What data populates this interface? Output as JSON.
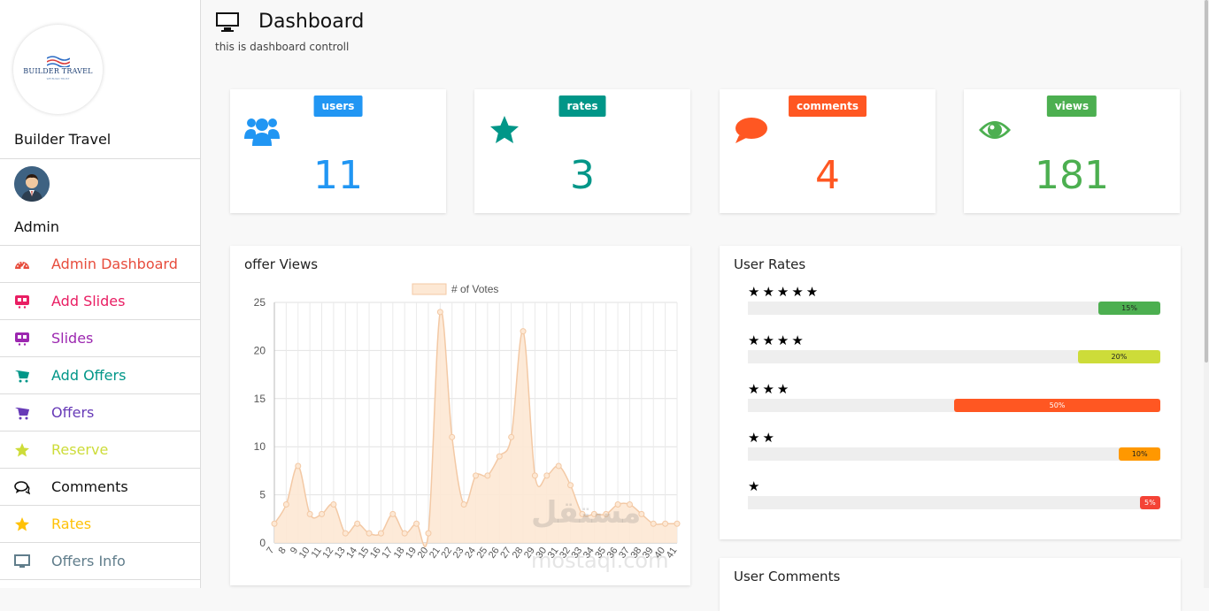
{
  "brand": {
    "logo_text": "BUILDER TRAVEL",
    "logo_sub": "WE BUILD TRUST",
    "name": "Builder Travel"
  },
  "user": {
    "role": "Admin"
  },
  "menu": [
    {
      "label": "Admin Dashboard",
      "icon": "dashboard-gauge-icon",
      "color": "#e74c3c"
    },
    {
      "label": "Add Slides",
      "icon": "slides-icon",
      "color": "#e91e63"
    },
    {
      "label": "Slides",
      "icon": "slides-icon",
      "color": "#9c27b0"
    },
    {
      "label": "Add Offers",
      "icon": "cart-icon",
      "color": "#009688"
    },
    {
      "label": "Offers",
      "icon": "cart-icon",
      "color": "#673ab7"
    },
    {
      "label": "Reserve",
      "icon": "star-icon",
      "color": "#cddc39"
    },
    {
      "label": "Comments",
      "icon": "comments-icon",
      "color": "#111111"
    },
    {
      "label": "Rates",
      "icon": "star-icon",
      "color": "#ffc107"
    },
    {
      "label": "Offers Info",
      "icon": "monitor-icon",
      "color": "#607d8b"
    }
  ],
  "header": {
    "title": "Dashboard",
    "subtitle": "this is dashboard controll",
    "icon": "monitor-icon"
  },
  "stats": [
    {
      "label": "users",
      "value": "11",
      "color": "#2196f3",
      "icon": "users-icon"
    },
    {
      "label": "rates",
      "value": "3",
      "color": "#009688",
      "icon": "star-icon"
    },
    {
      "label": "comments",
      "value": "4",
      "color": "#ff5722",
      "icon": "comment-icon"
    },
    {
      "label": "views",
      "value": "181",
      "color": "#4caf50",
      "icon": "eye-icon"
    }
  ],
  "offer_views": {
    "title": "offer Views",
    "chart_data": {
      "type": "area",
      "legend": "# of Votes",
      "x": [
        "7",
        "8",
        "9",
        "10",
        "11",
        "12",
        "13",
        "14",
        "15",
        "16",
        "17",
        "18",
        "19",
        "20",
        "21",
        "22",
        "23",
        "24",
        "25",
        "26",
        "27",
        "28",
        "29",
        "30",
        "31",
        "32",
        "33",
        "34",
        "35",
        "36",
        "37",
        "38",
        "39",
        "40",
        "41"
      ],
      "series": [
        {
          "name": "# of Votes",
          "values": [
            2,
            4,
            8,
            3,
            3,
            4,
            1,
            2,
            1,
            1,
            3,
            1,
            2,
            1,
            24,
            11,
            4,
            7,
            7,
            9,
            11,
            22,
            7,
            7,
            8,
            6,
            3,
            3,
            3,
            4,
            4,
            3,
            2,
            2,
            2
          ]
        }
      ],
      "yticks": [
        "0",
        "5",
        "10",
        "15",
        "20",
        "25"
      ],
      "ylim": [
        0,
        25
      ],
      "fill_color": "#fde8d4",
      "line_color": "#f3c9a5",
      "grid": true
    }
  },
  "user_rates": {
    "title": "User Rates",
    "rows": [
      {
        "stars": "★★★★★",
        "percent": 15,
        "label": "15%",
        "color": "#4caf50"
      },
      {
        "stars": "★★★★",
        "percent": 20,
        "label": "20%",
        "color": "#cddc39"
      },
      {
        "stars": "★★★",
        "percent": 50,
        "label": "50%",
        "color": "#ff5722"
      },
      {
        "stars": "★★",
        "percent": 10,
        "label": "10%",
        "color": "#ff9800"
      },
      {
        "stars": "★",
        "percent": 5,
        "label": "5%",
        "color": "#f44336"
      }
    ]
  },
  "user_comments": {
    "title": "User Comments"
  },
  "watermark": {
    "main": "مستقل",
    "sub": "mostaql.com"
  }
}
